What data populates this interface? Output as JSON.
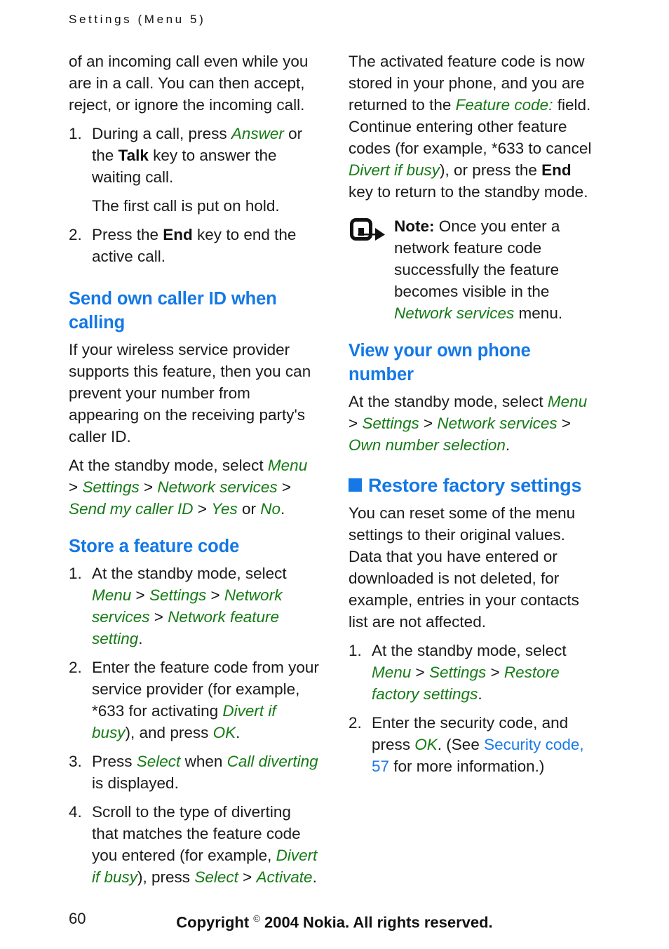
{
  "document": {
    "running_header": "Settings (Menu 5)",
    "page_number": "60",
    "copyright_pre": "Copyright ",
    "copyright_symbol": "©",
    "copyright_post": " 2004 Nokia. All rights reserved."
  },
  "colors": {
    "heading_blue": "#1478e6",
    "ui_term_green": "#157a15",
    "crossref_blue": "#1a7ae6",
    "body_black": "#1a1a1a",
    "page_background": "#ffffff"
  },
  "left_column": {
    "intro_paragraph": {
      "t1": "of an incoming call even while you are in a call. You can then accept, reject, or ignore the incoming call."
    },
    "call_waiting_steps": [
      {
        "num": "1.",
        "t1": "During a call, press ",
        "ui1": "Answer",
        "t2": " or the ",
        "kbd1": "Talk",
        "t3": " key to answer the waiting call.",
        "sub": "The first call is put on hold."
      },
      {
        "num": "2.",
        "t1": "Press the ",
        "kbd1": "End",
        "t2": " key to end the active call."
      }
    ],
    "caller_id_section": {
      "heading": "Send own caller ID when calling",
      "paragraph": "If your wireless service provider supports this feature, then you can prevent your number from appearing on the receiving party's caller ID.",
      "path_paragraph": {
        "t1": "At the standby mode, select ",
        "ui1": "Menu",
        "sep1": " > ",
        "ui2": "Settings",
        "sep2": " > ",
        "ui3": "Network services",
        "sep3": " > ",
        "ui4": "Send my caller ID",
        "sep4": " > ",
        "ui5": "Yes",
        "t2": " or ",
        "ui6": "No",
        "t3": "."
      }
    },
    "store_feature_code_section": {
      "heading": "Store a feature code",
      "steps": [
        {
          "num": "1.",
          "t1": "At the standby mode, select ",
          "ui1": "Menu",
          "sep1": " > ",
          "ui2": "Settings",
          "sep2": " > ",
          "ui3": "Network services",
          "sep3": " > ",
          "ui4": "Network feature setting",
          "t2": "."
        },
        {
          "num": "2.",
          "t1": "Enter the feature code from your service provider (for example, *633 for activating ",
          "ui1": "Divert if busy",
          "t2": "), and press ",
          "ui2": "OK",
          "t3": "."
        },
        {
          "num": "3.",
          "t1": "Press ",
          "ui1": "Select",
          "t2": " when ",
          "ui2": "Call diverting",
          "t3": " is displayed."
        },
        {
          "num": "4.",
          "t1": "Scroll to the type of diverting that matches the feature code you entered (for example, ",
          "ui1": "Divert if busy",
          "t2": "), press ",
          "ui2": "Select",
          "sep1": " > ",
          "ui3": "Activate",
          "t3": "."
        }
      ]
    }
  },
  "right_column": {
    "stored_code_paragraph": {
      "t1": "The activated feature code is now stored in your phone, and you are returned to the ",
      "ui1": "Feature code:",
      "t2": " field. Continue entering other feature codes (for example, *633 to cancel ",
      "ui2": "Divert if busy",
      "t3": "), or press the ",
      "kbd1": "End",
      "t4": " key to return to the standby mode."
    },
    "note": {
      "icon": "note-arrow-icon",
      "label": "Note:",
      "t1": " Once you enter a network feature code successfully the feature becomes visible in the ",
      "ui1": "Network services",
      "t2": " menu."
    },
    "view_number_section": {
      "heading": "View your own phone number",
      "path_paragraph": {
        "t1": "At the standby mode, select ",
        "ui1": "Menu",
        "sep1": " > ",
        "ui2": "Settings",
        "sep2": " > ",
        "ui3": "Network services",
        "sep3": " > ",
        "ui4": "Own number selection",
        "t2": "."
      }
    },
    "restore_factory_section": {
      "heading": "Restore factory settings",
      "paragraph": "You can reset some of the menu settings to their original values. Data that you have entered or downloaded is not deleted, for example, entries in your contacts list are not affected.",
      "steps": [
        {
          "num": "1.",
          "t1": "At the standby mode, select ",
          "ui1": "Menu",
          "sep1": " > ",
          "ui2": "Settings",
          "sep2": " > ",
          "ui3": "Restore factory settings",
          "t2": "."
        },
        {
          "num": "2.",
          "t1": "Enter the security code, and press ",
          "ui1": "OK",
          "t2": ". (See ",
          "xref1": "Security code, 57",
          "t3": " for more information.)"
        }
      ]
    }
  }
}
